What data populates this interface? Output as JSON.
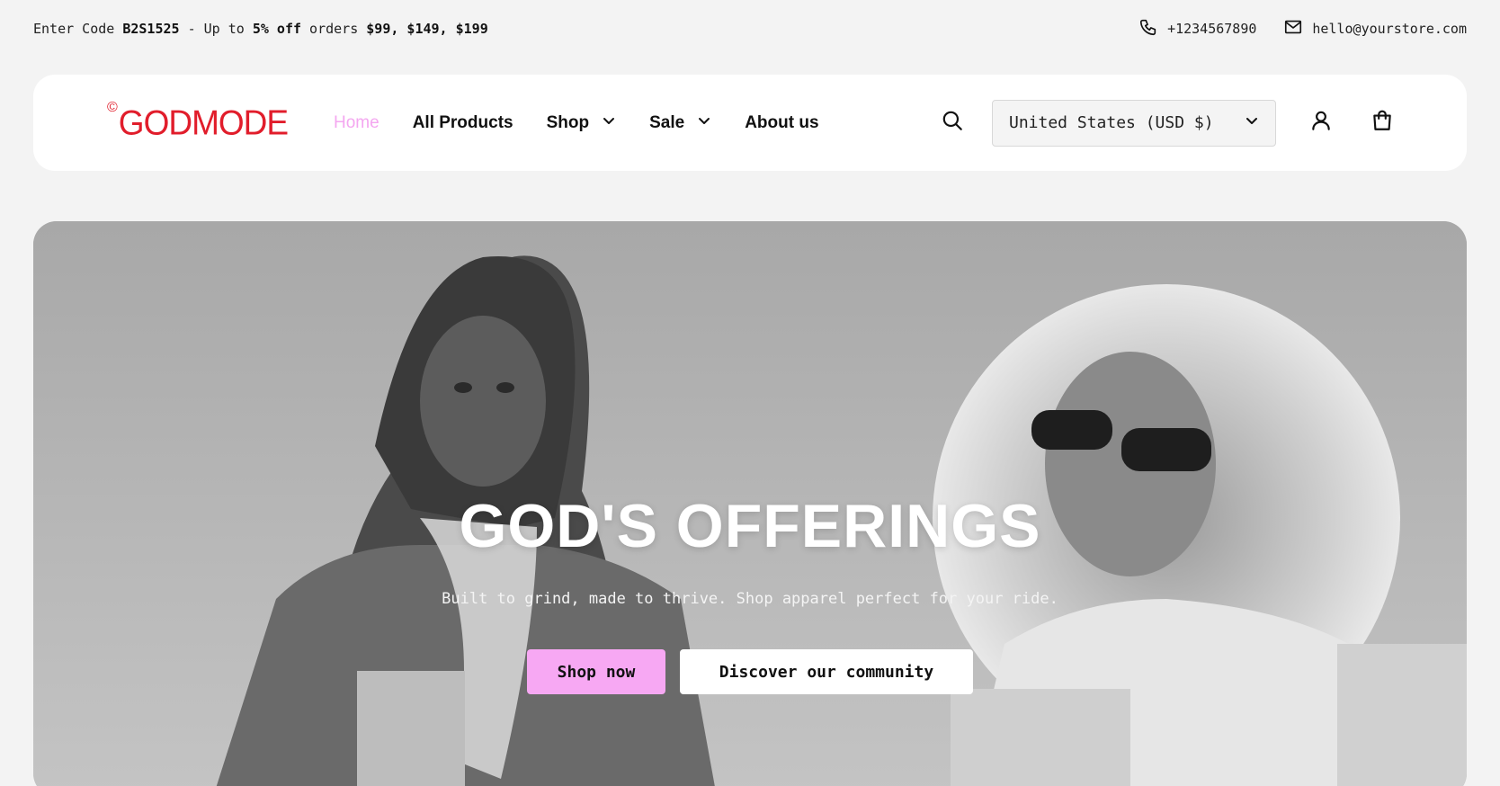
{
  "announcement": {
    "prefix": "Enter Code ",
    "code": "B2S1525",
    "middle": " - Up to ",
    "discount": "5% off",
    "orders_text": " orders ",
    "thresholds": "$99, $149, $199"
  },
  "contact": {
    "phone": "+1234567890",
    "email": "hello@yourstore.com"
  },
  "header": {
    "logo_text": "GODMODE",
    "logo_symbol": "©",
    "nav": [
      {
        "label": "Home",
        "active": true
      },
      {
        "label": "All Products"
      },
      {
        "label": "Shop",
        "dropdown": true
      },
      {
        "label": "Sale",
        "dropdown": true
      },
      {
        "label": "About us"
      }
    ],
    "country_selector": "United States (USD $)"
  },
  "hero": {
    "title": "GOD'S OFFERINGS",
    "subtitle": "Built to grind, made to thrive. Shop apparel perfect for your ride.",
    "primary_button": "Shop now",
    "secondary_button": "Discover our community"
  },
  "colors": {
    "accent_pink": "#f7a8f3",
    "logo_red": "#e11d2b",
    "background": "#f3f3f3"
  },
  "icons": [
    "phone-icon",
    "mail-icon",
    "search-icon",
    "chevron-down-icon",
    "user-icon",
    "shopping-bag-icon"
  ]
}
